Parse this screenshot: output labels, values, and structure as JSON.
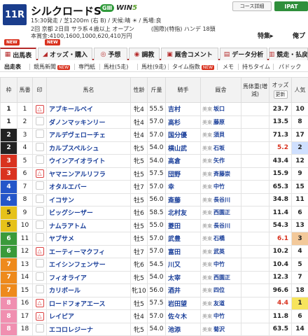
{
  "header": {
    "race_no": "11R",
    "race_name": "シルクロードS",
    "grade": "GⅢ",
    "win5_prefix": "WIN",
    "win5_suffix": "5",
    "line1": "15:30発走 / 芝1200m (右 B) / 天候:晴 ☀ / 馬場:良",
    "line2": "2回 京都 2日目 サラ系４歳以上 オープン　　　(国際)(特指) ハンデ 18頭",
    "line3": "本賞金:4100,1600,1000,620,410万円",
    "course_button": "コース詳細",
    "ipat_button": "IPAT",
    "special": "特集▸",
    "past": "俺プ"
  },
  "tabs": [
    {
      "label": "出馬表",
      "icon": "▦"
    },
    {
      "label": "オッズ・購入",
      "icon": "◢"
    },
    {
      "label": "予想",
      "icon": "◎"
    },
    {
      "label": "調教",
      "icon": "◉"
    },
    {
      "label": "厩舎コメント",
      "icon": "▣"
    },
    {
      "label": "データ分析",
      "icon": "▤"
    },
    {
      "label": "競走・払戻",
      "icon": "▥"
    }
  ],
  "new_label": "NEW",
  "subtabs": [
    "出走表",
    "競馬新聞",
    "専門紙",
    "馬柱(5走)",
    "馬柱(9走)",
    "タイム指数",
    "メモ",
    "持ちタイム",
    "パドック"
  ],
  "columns": {
    "waku": "枠",
    "umaban": "馬番",
    "mark": "印",
    "mark_sub": "印 切替",
    "name": "馬名",
    "sexage": "性齢",
    "weight": "斤量",
    "jockey": "騎手",
    "trainer": "厩舎",
    "body": "馬体重(増減)",
    "odds": "オッズ",
    "odds_btn": "更新",
    "pop": "人気"
  },
  "horses": [
    {
      "waku": "1",
      "no": "1",
      "name": "アブキールベイ",
      "sexage": "牝4",
      "weight": "55.5",
      "jockey": "吉村",
      "region": "美東",
      "trainer": "坂口",
      "odds": "23.7",
      "pop": "10"
    },
    {
      "waku": "1",
      "no": "2",
      "name": "ダノンマッキンリー",
      "sexage": "牡4",
      "weight": "57.0",
      "jockey": "高杉",
      "region": "美東",
      "trainer": "藤原",
      "odds": "13.5",
      "pop": "8"
    },
    {
      "waku": "2",
      "no": "3",
      "name": "アルデヴェローチェ",
      "sexage": "牡4",
      "weight": "57.0",
      "jockey": "国分優",
      "region": "美東",
      "trainer": "須貝",
      "odds": "71.3",
      "pop": "17"
    },
    {
      "waku": "2",
      "no": "4",
      "name": "カルプスペルシュ",
      "sexage": "牝5",
      "weight": "54.0",
      "jockey": "横山武",
      "region": "美東",
      "trainer": "石坂",
      "odds": "5.2",
      "pop": "2"
    },
    {
      "waku": "3",
      "no": "5",
      "name": "ウインアイオライト",
      "sexage": "牝5",
      "weight": "54.0",
      "jockey": "高倉",
      "region": "美東",
      "trainer": "矢作",
      "odds": "43.4",
      "pop": "12"
    },
    {
      "waku": "3",
      "no": "6",
      "name": "ヤマニンアルリフラ",
      "sexage": "牡5",
      "weight": "57.5",
      "jockey": "団野",
      "region": "美東",
      "trainer": "斉藤崇",
      "odds": "15.9",
      "pop": "9"
    },
    {
      "waku": "4",
      "no": "7",
      "name": "オタルエバー",
      "sexage": "牡7",
      "weight": "57.0",
      "jockey": "幸",
      "region": "美東",
      "trainer": "中竹",
      "odds": "65.3",
      "pop": "15"
    },
    {
      "waku": "4",
      "no": "8",
      "name": "イコサン",
      "sexage": "牡5",
      "weight": "56.0",
      "jockey": "斎藤",
      "region": "美東",
      "trainer": "長谷川",
      "odds": "34.8",
      "pop": "11"
    },
    {
      "waku": "5",
      "no": "9",
      "name": "ビッグシーザー",
      "sexage": "牡6",
      "weight": "58.5",
      "jockey": "北村友",
      "region": "美東",
      "trainer": "西園正",
      "odds": "11.4",
      "pop": "6"
    },
    {
      "waku": "5",
      "no": "10",
      "name": "ナムラアトム",
      "sexage": "牡5",
      "weight": "55.0",
      "jockey": "菱田",
      "region": "美東",
      "trainer": "長谷川",
      "odds": "54.3",
      "pop": "13"
    },
    {
      "waku": "6",
      "no": "11",
      "name": "ヤブサメ",
      "sexage": "牡5",
      "weight": "57.0",
      "jockey": "武豊",
      "region": "美東",
      "trainer": "石橋",
      "odds": "6.1",
      "pop": "3"
    },
    {
      "waku": "6",
      "no": "12",
      "name": "エーティーマクフィ",
      "sexage": "牡7",
      "weight": "57.0",
      "jockey": "富田",
      "region": "美東",
      "trainer": "武英",
      "odds": "10.2",
      "pop": "4"
    },
    {
      "waku": "7",
      "no": "13",
      "name": "エイシンフェンサー",
      "sexage": "牝6",
      "weight": "54.5",
      "jockey": "川又",
      "region": "美東",
      "trainer": "中竹",
      "odds": "10.4",
      "pop": "5"
    },
    {
      "waku": "7",
      "no": "14",
      "name": "フィオライア",
      "sexage": "牝5",
      "weight": "54.0",
      "jockey": "太宰",
      "region": "美東",
      "trainer": "西園正",
      "odds": "12.3",
      "pop": "7"
    },
    {
      "waku": "7",
      "no": "15",
      "name": "カリボール",
      "sexage": "牝10",
      "weight": "56.0",
      "jockey": "酒井",
      "region": "美東",
      "trainer": "四位",
      "odds": "96.6",
      "pop": "18"
    },
    {
      "waku": "8",
      "no": "16",
      "name": "ロードフォアエース",
      "sexage": "牡5",
      "weight": "57.5",
      "jockey": "岩田望",
      "region": "美東",
      "trainer": "友道",
      "odds": "4.4",
      "pop": "1"
    },
    {
      "waku": "8",
      "no": "17",
      "name": "レイピア",
      "sexage": "牡4",
      "weight": "57.0",
      "jockey": "佐々木",
      "region": "美東",
      "trainer": "中竹",
      "odds": "11.8",
      "pop": "6"
    },
    {
      "waku": "8",
      "no": "18",
      "name": "エコロレジーナ",
      "sexage": "牝5",
      "weight": "54.0",
      "jockey": "池添",
      "region": "美東",
      "trainer": "菊沢",
      "odds": "63.5",
      "pop": "14"
    }
  ],
  "marks": [
    "△",
    "",
    "",
    "",
    "",
    "△",
    "",
    "",
    "",
    "",
    "",
    "△",
    "",
    "",
    "",
    "△",
    "△",
    ""
  ]
}
